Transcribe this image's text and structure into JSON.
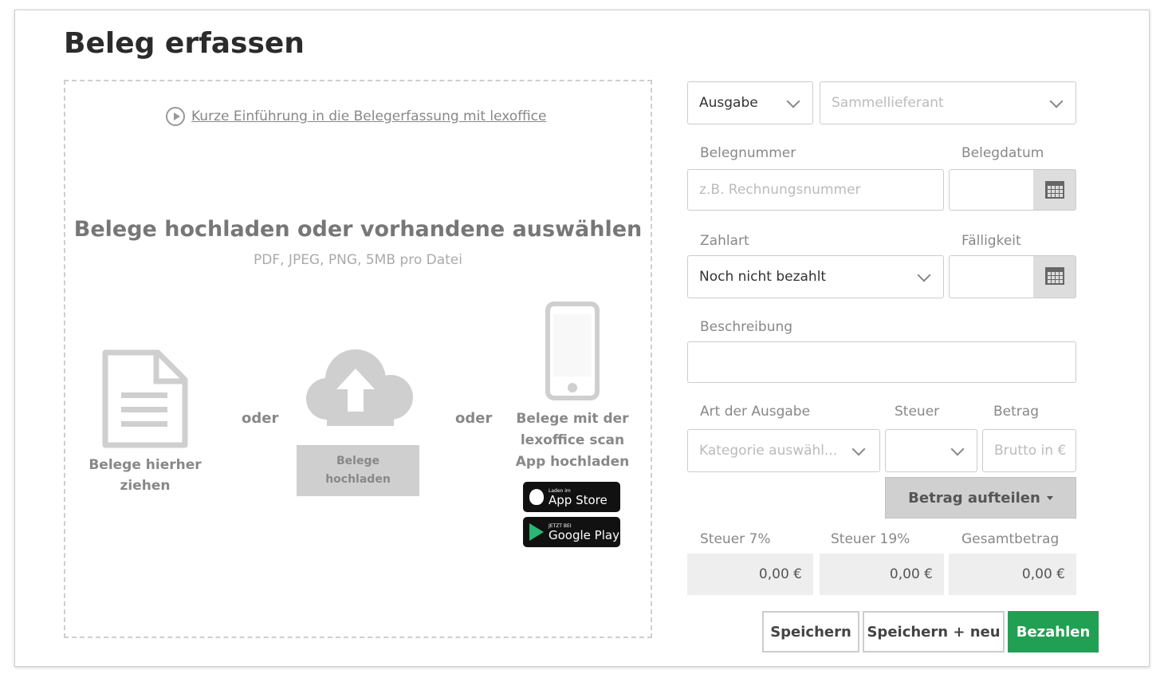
{
  "page": {
    "title": "Beleg erfassen"
  },
  "upload": {
    "intro_link": "Kurze Einführung in die Belegerfassung mit lexoffice",
    "heading": "Belege hochladen oder vorhandene auswählen",
    "subheading": "PDF, JPEG, PNG, 5MB pro Datei",
    "drag_label_line1": "Belege hierher",
    "drag_label_line2": "ziehen",
    "or_label": "oder",
    "upload_button_line1": "Belege",
    "upload_button_line2": "hochladen",
    "app_label_line1": "Belege mit der",
    "app_label_line2": "lexoffice scan",
    "app_label_line3": "App hochladen",
    "appstore_small": "Laden im",
    "appstore_big": "App Store",
    "googleplay_small": "JETZT BEI",
    "googleplay_big": "Google Play"
  },
  "form": {
    "type_select": "Ausgabe",
    "supplier_placeholder": "Sammellieferant",
    "belegnummer_label": "Belegnummer",
    "belegnummer_placeholder": "z.B. Rechnungsnummer",
    "belegdatum_label": "Belegdatum",
    "belegdatum_value": "",
    "zahlart_label": "Zahlart",
    "zahlart_value": "Noch nicht bezahlt",
    "faelligkeit_label": "Fälligkeit",
    "faelligkeit_value": "",
    "beschreibung_label": "Beschreibung",
    "beschreibung_value": "",
    "art_label": "Art der Ausgabe",
    "art_placeholder": "Kategorie auswähl...",
    "steuer_label": "Steuer",
    "steuer_value": "",
    "betrag_label": "Betrag",
    "betrag_placeholder": "Brutto in €",
    "split_button": "Betrag aufteilen"
  },
  "totals": {
    "tax7_label": "Steuer 7%",
    "tax7_value": "0,00 €",
    "tax19_label": "Steuer 19%",
    "tax19_value": "0,00 €",
    "total_label": "Gesamtbetrag",
    "total_value": "0,00 €"
  },
  "actions": {
    "save": "Speichern",
    "save_new": "Speichern + neu",
    "pay": "Bezahlen"
  },
  "colors": {
    "primary": "#21a053",
    "border": "#cccccc",
    "muted_text": "#888888"
  },
  "icons": [
    "play-circle-icon",
    "document-icon",
    "cloud-upload-icon",
    "smartphone-icon",
    "apple-icon",
    "google-play-icon",
    "chevron-down-icon",
    "calendar-icon",
    "caret-down-icon"
  ]
}
